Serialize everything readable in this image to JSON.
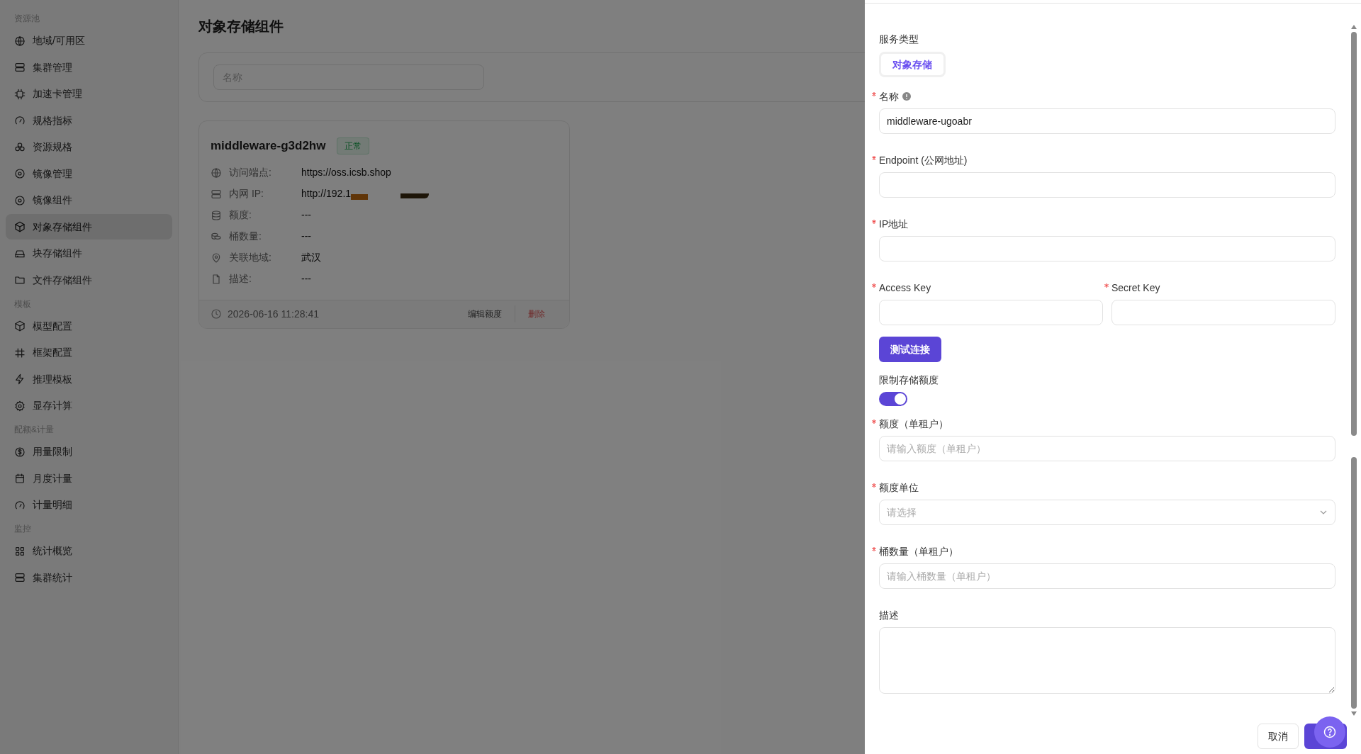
{
  "sidebar": {
    "sections": [
      {
        "title": "资源池",
        "items": [
          {
            "label": "地域/可用区",
            "selected": false
          },
          {
            "label": "集群管理",
            "selected": false
          },
          {
            "label": "加速卡管理",
            "selected": false
          },
          {
            "label": "规格指标",
            "selected": false
          },
          {
            "label": "资源规格",
            "selected": false
          },
          {
            "label": "镜像管理",
            "selected": false
          },
          {
            "label": "镜像组件",
            "selected": false
          },
          {
            "label": "对象存储组件",
            "selected": true
          },
          {
            "label": "块存储组件",
            "selected": false
          },
          {
            "label": "文件存储组件",
            "selected": false
          }
        ]
      },
      {
        "title": "模板",
        "items": [
          {
            "label": "模型配置",
            "selected": false
          },
          {
            "label": "框架配置",
            "selected": false
          },
          {
            "label": "推理模板",
            "selected": false
          },
          {
            "label": "显存计算",
            "selected": false
          }
        ]
      },
      {
        "title": "配额&计量",
        "items": [
          {
            "label": "用量限制",
            "selected": false
          },
          {
            "label": "月度计量",
            "selected": false
          },
          {
            "label": "计量明细",
            "selected": false
          }
        ]
      },
      {
        "title": "监控",
        "items": [
          {
            "label": "统计概览",
            "selected": false
          },
          {
            "label": "集群统计",
            "selected": false
          }
        ]
      }
    ]
  },
  "page": {
    "title": "对象存储组件",
    "filter": {
      "placeholder": "名称"
    },
    "cards": [
      {
        "name": "middleware-g3d2hw",
        "status": "正常",
        "fields": [
          {
            "label": "访问端点:",
            "value": "https://oss.icsb.shop",
            "redacted": false
          },
          {
            "label": "内网 IP:",
            "value": "http://192.1",
            "redacted": true
          },
          {
            "label": "额度:",
            "value": "---",
            "redacted": false
          },
          {
            "label": "桶数量:",
            "value": "---",
            "redacted": false
          },
          {
            "label": "关联地域:",
            "value": "武汉",
            "redacted": false
          },
          {
            "label": "描述:",
            "value": "---",
            "redacted": false
          }
        ],
        "time": "2026-06-16 11:28:41",
        "actions": [
          {
            "label": "编辑额度",
            "kind": "normal"
          },
          {
            "label": "删除",
            "kind": "danger"
          }
        ]
      }
    ]
  },
  "drawer": {
    "service_type": {
      "label": "服务类型",
      "options": [
        {
          "label": "对象存储",
          "selected": true
        }
      ]
    },
    "fields": [
      {
        "kind": "text",
        "label": "名称",
        "required": true,
        "hint_icon": true,
        "value": "middleware-ugoabr"
      },
      {
        "kind": "text",
        "label": "Endpoint (公网地址)",
        "required": true,
        "hint_icon": false
      },
      {
        "kind": "text",
        "label": "IP地址",
        "required": true,
        "hint_icon": false
      },
      {
        "kind": "pair",
        "items": [
          {
            "label": "Access Key",
            "required": true
          },
          {
            "label": "Secret Key",
            "required": true
          }
        ]
      },
      {
        "kind": "button",
        "label": "测试连接"
      },
      {
        "kind": "switch",
        "label": "限制存储额度",
        "required": false,
        "on": true
      },
      {
        "kind": "text",
        "label": "额度（单租户）",
        "required": true,
        "hint_icon": false,
        "placeholder": "请输入额度（单租户）"
      },
      {
        "kind": "select",
        "label": "额度单位",
        "required": true,
        "placeholder": "请选择"
      },
      {
        "kind": "text",
        "label": "桶数量（单租户）",
        "required": true,
        "hint_icon": false,
        "placeholder": "请输入桶数量（单租户）"
      },
      {
        "kind": "textarea",
        "label": "描述",
        "required": false
      }
    ],
    "footer": {
      "cancel": "取消"
    }
  }
}
